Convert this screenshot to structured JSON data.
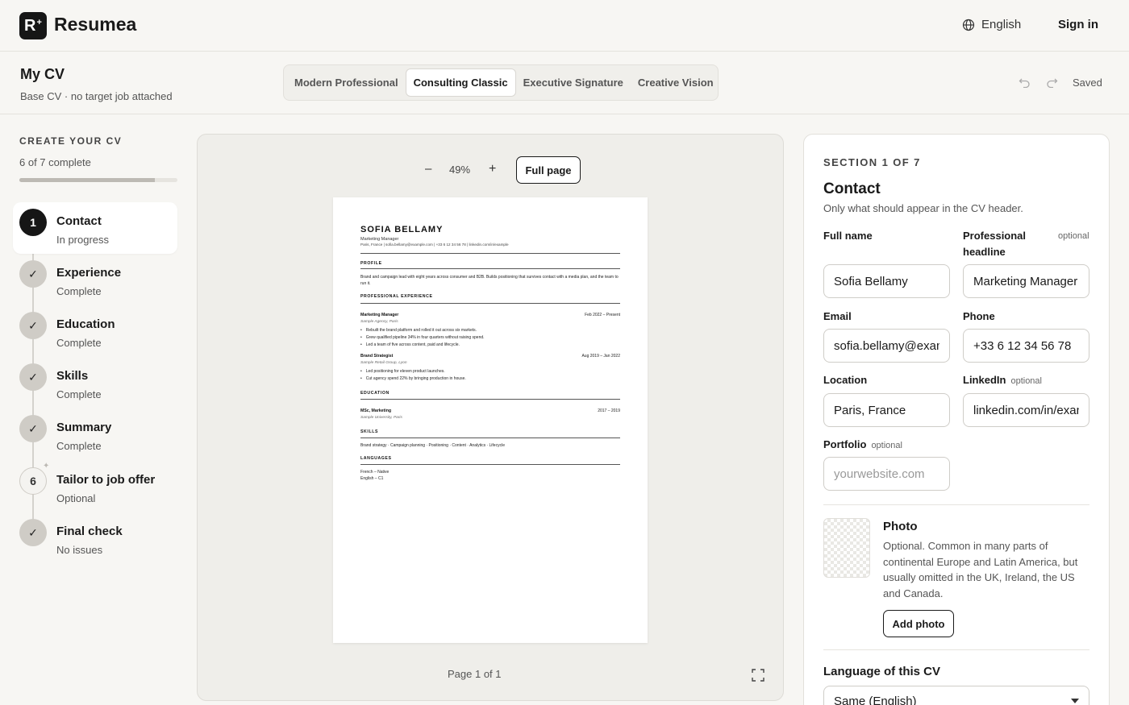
{
  "app": {
    "brand": "Resumea",
    "logo_letter": "R",
    "logo_mark": "+",
    "language": "English",
    "sign_in": "Sign in"
  },
  "header": {
    "title": "My CV",
    "subtitle": "Base CV · no target job attached",
    "templates": [
      "Modern Professional",
      "Consulting Classic",
      "Executive Signature",
      "Creative Vision"
    ],
    "active_template": "Consulting Classic",
    "saved": "Saved"
  },
  "sidebar": {
    "title": "CREATE YOUR CV",
    "progress_text": "6 of 7 complete",
    "progress_fraction": 0.857,
    "steps": [
      {
        "number": "1",
        "label": "Contact",
        "status": "In progress",
        "state": "current"
      },
      {
        "number": "✓",
        "label": "Experience",
        "status": "Complete",
        "state": "done"
      },
      {
        "number": "✓",
        "label": "Education",
        "status": "Complete",
        "state": "done"
      },
      {
        "number": "✓",
        "label": "Skills",
        "status": "Complete",
        "state": "done"
      },
      {
        "number": "✓",
        "label": "Summary",
        "status": "Complete",
        "state": "done"
      },
      {
        "number": "6",
        "label": "Tailor to job offer",
        "status": "Optional",
        "state": "optional"
      },
      {
        "number": "✓",
        "label": "Final check",
        "status": "No issues",
        "state": "done"
      }
    ]
  },
  "preview": {
    "zoom_out": "–",
    "zoom": "49%",
    "zoom_in": "+",
    "full_page": "Full page",
    "page_indicator": "Page 1 of 1",
    "cv": {
      "name": "SOFIA BELLAMY",
      "role": "Marketing Manager",
      "contact": "Paris, France | sofia.bellamy@example.com | +33 6 12 34 56 78 | linkedin.com/in/example",
      "profile_heading": "PROFILE",
      "profile_text": "Brand and campaign lead with eight years across consumer and B2B. Builds positioning that survives contact with a media plan, and the team to run it.",
      "experience_heading": "PROFESSIONAL EXPERIENCE",
      "jobs": [
        {
          "title": "Marketing Manager",
          "dates": "Feb 2022 – Present",
          "org": "Sample Agency, Paris",
          "bullets": [
            "Rebuilt the brand platform and rolled it out across six markets.",
            "Grew qualified pipeline 34% in four quarters without raising spend.",
            "Led a team of five across content, paid and lifecycle."
          ]
        },
        {
          "title": "Brand Strategist",
          "dates": "Aug 2019 – Jan 2022",
          "org": "Sample Retail Group, Lyon",
          "bullets": [
            "Led positioning for eleven product launches.",
            "Cut agency spend 22% by bringing production in house."
          ]
        }
      ],
      "education_heading": "EDUCATION",
      "degree": "MSc, Marketing",
      "degree_dates": "2017 – 2019",
      "school": "Sample University, Paris",
      "skills_heading": "SKILLS",
      "skills": "Brand strategy · Campaign planning · Positioning · Content · Analytics · Lifecycle",
      "languages_heading": "LANGUAGES",
      "languages": [
        "French – Native",
        "English – C1"
      ]
    }
  },
  "form": {
    "section": "SECTION 1 OF 7",
    "title": "Contact",
    "subtitle": "Only what should appear in the CV header.",
    "optional": "optional",
    "full_name_label": "Full name",
    "full_name": "Sofia Bellamy",
    "headline_label": "Professional headline",
    "headline": "Marketing Manager",
    "email_label": "Email",
    "email": "sofia.bellamy@example.com",
    "phone_label": "Phone",
    "phone": "+33 6 12 34 56 78",
    "location_label": "Location",
    "location": "Paris, France",
    "linkedin_label": "LinkedIn",
    "linkedin": "linkedin.com/in/example",
    "portfolio_label": "Portfolio",
    "portfolio_placeholder": "yourwebsite.com",
    "photo_title": "Photo",
    "photo_desc": "Optional. Common in many parts of continental Europe and Latin America, but usually omitted in the UK, Ireland, the US and Canada.",
    "add_photo": "Add photo",
    "language_label": "Language of this CV",
    "language_value": "Same (English)"
  },
  "icons": {
    "globe": "globe-icon",
    "undo": "undo-icon",
    "redo": "redo-icon",
    "check": "check-icon",
    "expand": "expand-icon",
    "sparkle": "sparkle-icon",
    "chevron": "chevron-down-icon"
  }
}
